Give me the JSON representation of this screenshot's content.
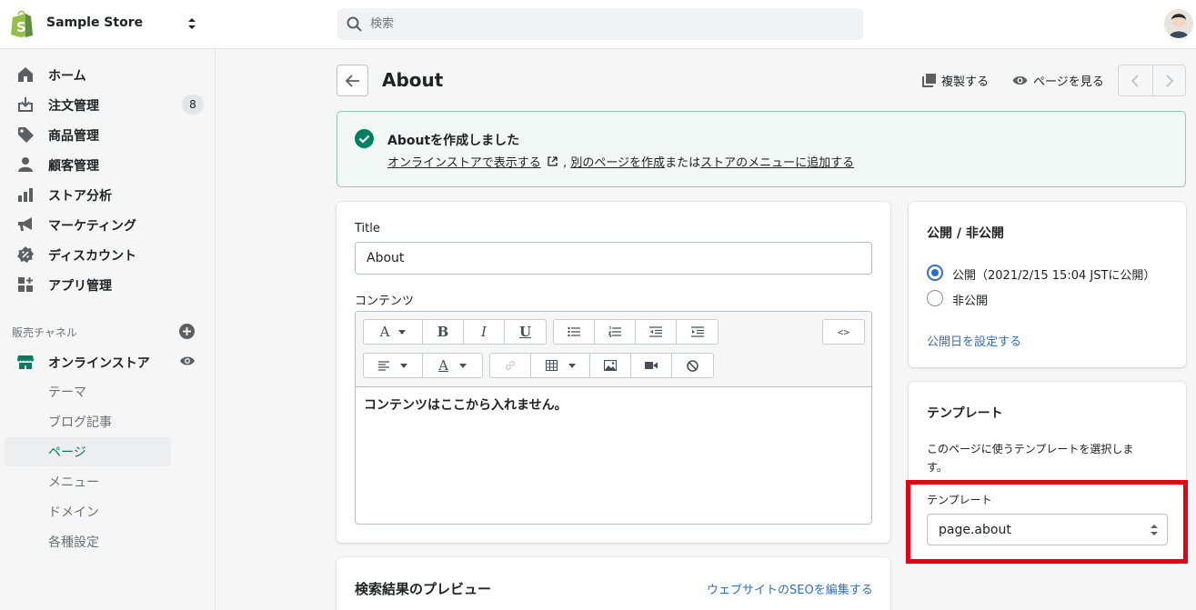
{
  "app": {
    "store_name": "Sample Store",
    "search_placeholder": "検索"
  },
  "sidebar": {
    "items": [
      {
        "label": "ホーム",
        "icon": "home-icon"
      },
      {
        "label": "注文管理",
        "icon": "orders-icon",
        "badge": "8"
      },
      {
        "label": "商品管理",
        "icon": "tag-icon"
      },
      {
        "label": "顧客管理",
        "icon": "customer-icon"
      },
      {
        "label": "ストア分析",
        "icon": "analytics-icon"
      },
      {
        "label": "マーケティング",
        "icon": "megaphone-icon"
      },
      {
        "label": "ディスカウント",
        "icon": "discount-icon"
      },
      {
        "label": "アプリ管理",
        "icon": "apps-icon"
      }
    ],
    "channels_title": "販売チャネル",
    "online_store": "オンラインストア",
    "sub_items": [
      "テーマ",
      "ブログ記事",
      "ページ",
      "メニュー",
      "ドメイン",
      "各種設定"
    ],
    "active_sub_item": "ページ"
  },
  "header": {
    "title": "About",
    "duplicate_label": "複製する",
    "view_label": "ページを見る"
  },
  "banner": {
    "title": "Aboutを作成しました",
    "link_view": "オンラインストアで表示する",
    "sep1": ",",
    "link_create": "別のページを作成",
    "text_or": "または",
    "link_menu": "ストアのメニューに追加する"
  },
  "main_card": {
    "title_label": "Title",
    "title_value": "About",
    "content_label": "コンテンツ",
    "editor_text": "コンテンツはここから入れません。",
    "toolbar": {
      "font": "A",
      "bold": "B",
      "italic": "I",
      "underline": "U",
      "code": "<>",
      "color": "A"
    }
  },
  "visibility": {
    "heading": "公開 / 非公開",
    "option_visible": "公開（2021/2/15 15:04 JSTに公開）",
    "option_hidden": "非公開",
    "selected": "公開",
    "set_date_link": "公開日を設定する"
  },
  "template": {
    "heading": "テンプレート",
    "description": "このページに使うテンプレートを選択します。",
    "select_label": "テンプレート",
    "select_value": "page.about"
  },
  "seo": {
    "heading": "検索結果のプレビュー",
    "edit_link": "ウェブサイトのSEOを編集する"
  },
  "colors": {
    "accent": "#2c6ecb",
    "success": "#008060",
    "highlight": "#e60012"
  }
}
